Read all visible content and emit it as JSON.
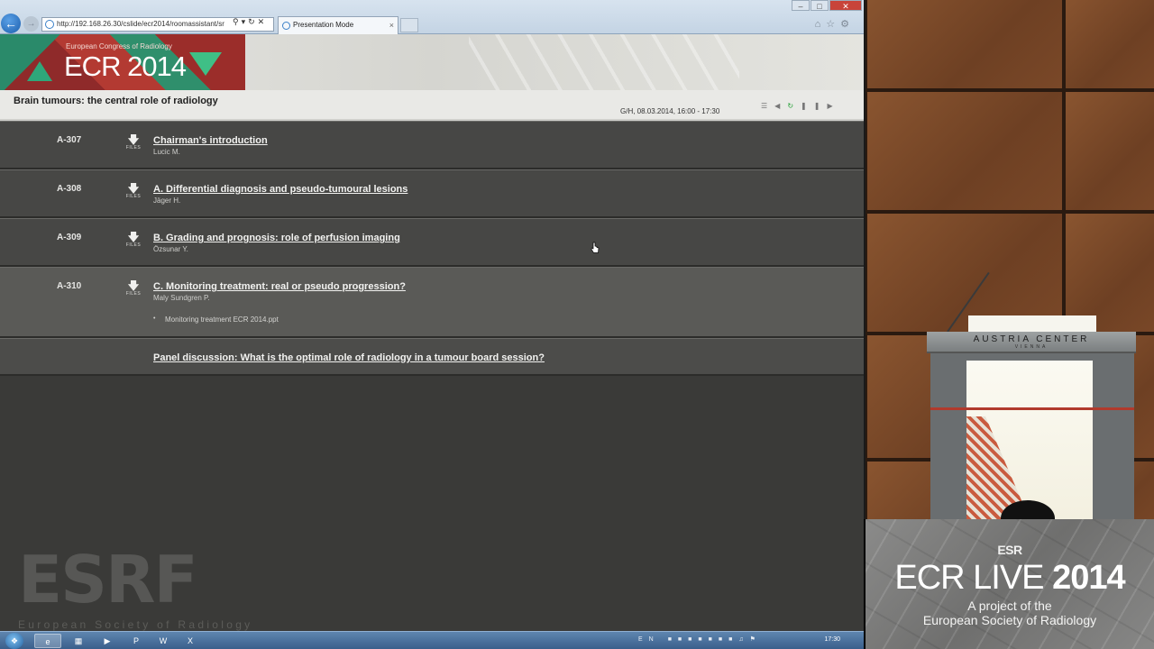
{
  "browser": {
    "url": "http://192.168.26.30/cslide/ecr2014/roomassistant/sr",
    "tab_title": "Presentation Mode",
    "window_controls": {
      "minimize": "–",
      "maximize": "□",
      "close": "✕"
    }
  },
  "banner": {
    "kicker": "European Congress of Radiology",
    "name": "ECR 2014"
  },
  "session": {
    "title": "Brain tumours: the central role of radiology",
    "time": "G/H, 08.03.2014, 16:00 - 17:30"
  },
  "download_label": "FILES",
  "talks": [
    {
      "code": "A-307",
      "title": "Chairman's introduction",
      "author": "Lucic M."
    },
    {
      "code": "A-308",
      "title": "A. Differential diagnosis and pseudo-tumoural lesions",
      "author": "Jäger H."
    },
    {
      "code": "A-309",
      "title": "B. Grading and prognosis: role of perfusion imaging",
      "author": "Özsunar Y."
    },
    {
      "code": "A-310",
      "title": "C. Monitoring treatment: real or pseudo progression?",
      "author": "Maly Sundgren P.",
      "file": "Monitoring treatment ECR 2014.ppt"
    }
  ],
  "panel": {
    "title": "Panel discussion: What is the optimal role of radiology in a tumour board session?"
  },
  "esr": {
    "letters": "ESRF",
    "caption": "European Society of Radiology"
  },
  "taskbar": {
    "language": "EN",
    "clock": "17:30"
  },
  "lectern": {
    "name": "AUSTRIA CENTER",
    "city": "VIENNA"
  },
  "brand": {
    "logo": "ESR",
    "title_light": "ECR LIVE",
    "title_bold": "2014",
    "sub1": "A project of the",
    "sub2": "European Society of Radiology"
  },
  "colors": {
    "screen_bg": "#3a3a38",
    "row_bg": "#474745",
    "row_highlight": "#5a5a57",
    "accent_green": "#22a035",
    "taskbar": "#3a5f8b"
  }
}
